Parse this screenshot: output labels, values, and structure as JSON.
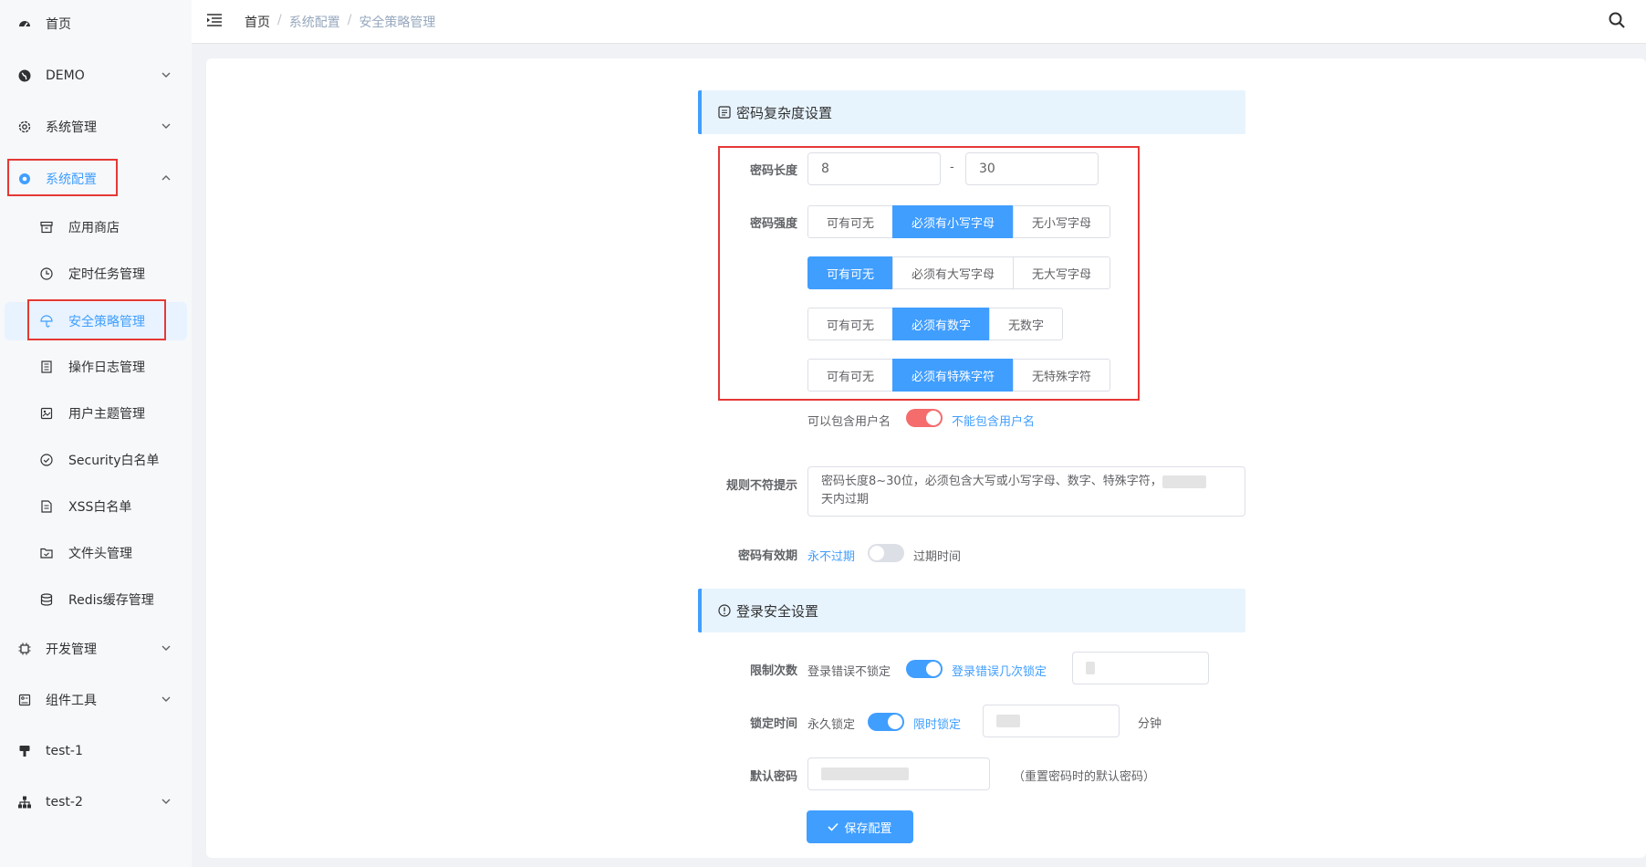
{
  "sidebar": {
    "home": "首页",
    "demo": "DEMO",
    "sys_manage": "系统管理",
    "sys_config": "系统配置",
    "sub": {
      "app_store": "应用商店",
      "cron": "定时任务管理",
      "security_policy": "安全策略管理",
      "op_log": "操作日志管理",
      "user_theme": "用户主题管理",
      "security_whitelist": "Security白名单",
      "xss_whitelist": "XSS白名单",
      "file_header": "文件头管理",
      "redis_cache": "Redis缓存管理"
    },
    "dev_manage": "开发管理",
    "components": "组件工具",
    "test1": "test-1",
    "test2": "test-2"
  },
  "header": {
    "breadcrumb": [
      "首页",
      "系统配置",
      "安全策略管理"
    ],
    "sep": "/"
  },
  "password_section": {
    "title": "密码复杂度设置",
    "length_label": "密码长度",
    "length_min": "8",
    "length_dash": "-",
    "length_max": "30",
    "strength_label": "密码强度",
    "lower_group": [
      "可有可无",
      "必须有小写字母",
      "无小写字母"
    ],
    "upper_group": [
      "可有可无",
      "必须有大写字母",
      "无大写字母"
    ],
    "digit_group": [
      "可有可无",
      "必须有数字",
      "无数字"
    ],
    "special_group": [
      "可有可无",
      "必须有特殊字符",
      "无特殊字符"
    ],
    "username_off": "可以包含用户名",
    "username_on": "不能包含用户名",
    "hint_label": "规则不符提示",
    "hint_text_1": "密码长度8~30位，必须包含大写或小写字母、数字、特殊字符，",
    "hint_text_2": "天内过期",
    "expire_label": "密码有效期",
    "expire_never": "永不过期",
    "expire_time": "过期时间"
  },
  "login_section": {
    "title": "登录安全设置",
    "limit_label": "限制次数",
    "limit_off": "登录错误不锁定",
    "limit_on": "登录错误几次锁定",
    "lock_label": "锁定时间",
    "lock_off": "永久锁定",
    "lock_on": "限时锁定",
    "lock_unit": "分钟",
    "default_pw_label": "默认密码",
    "default_pw_note": "（重置密码时的默认密码）",
    "save": "保存配置"
  },
  "colors": {
    "accent": "#409eff",
    "switch_red": "#f56c6c",
    "highlight_border": "#e53935"
  }
}
